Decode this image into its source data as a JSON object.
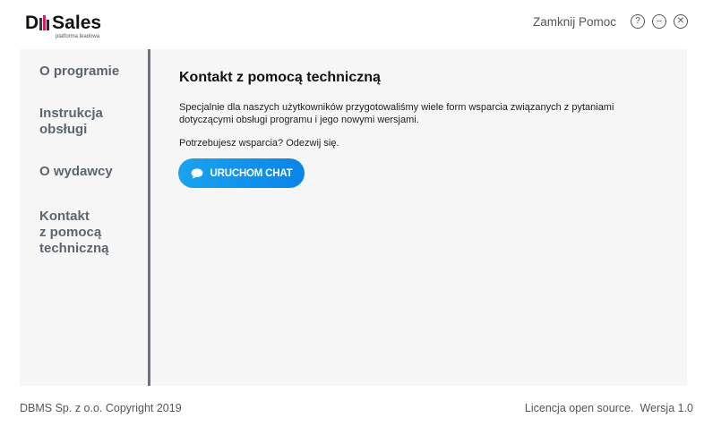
{
  "header": {
    "logo": {
      "brand_prefix": "D",
      "brand_name": "Sales",
      "subtitle": "platforma leadowa"
    },
    "close_help_label": "Zamknij Pomoc",
    "help_icon_glyph": "?",
    "minimize_icon_glyph": "–",
    "close_icon_glyph": "✕"
  },
  "sidebar": {
    "items": [
      {
        "label": "O programie"
      },
      {
        "label": "Instrukcja\nobsługi"
      },
      {
        "label": "O wydawcy"
      },
      {
        "label": "Kontakt\nz pomocą\ntechniczną"
      }
    ]
  },
  "content": {
    "title": "Kontakt z pomocą techniczną",
    "description": "Specjalnie dla naszych użytkowników przygotowaliśmy wiele form wsparcia związanych z pytaniami dotyczącymi obsługi programu i jego nowymi wersjami.",
    "prompt": "Potrzebujesz wsparcia? Odezwij się.",
    "chat_button_label": "URUCHOM CHAT"
  },
  "footer": {
    "copyright": "DBMS Sp. z o.o. Copyright 2019",
    "license": "Licencja open source.",
    "version": "Wersja 1.0"
  },
  "colors": {
    "accent": "#0a84e8",
    "brand_pink": "#e8175d",
    "panel_bg": "#f6f6f6",
    "sidebar_text": "#5c6570"
  }
}
